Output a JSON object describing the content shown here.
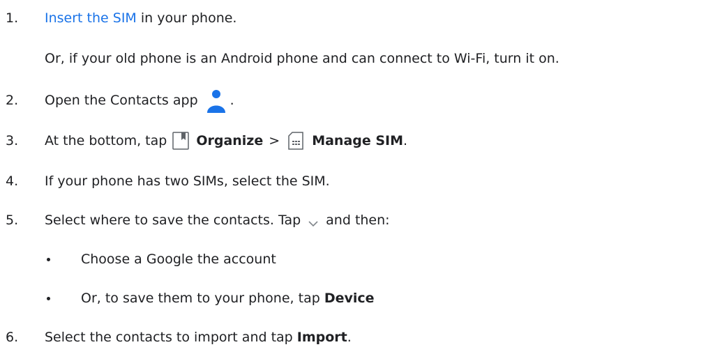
{
  "steps": [
    {
      "number": "1.",
      "link": "Insert the SIM",
      "text_after_link": " in your phone.",
      "note": "Or, if your old phone is an Android phone and can connect to Wi-Fi, turn it on."
    },
    {
      "number": "2.",
      "text_before_icon": "Open the Contacts app",
      "text_after_icon": "."
    },
    {
      "number": "3.",
      "text_before": "At the bottom, tap",
      "organize_label": "Organize",
      "separator": ">",
      "manage_sim_label": "Manage SIM",
      "text_end": "."
    },
    {
      "number": "4.",
      "text": "If your phone has two SIMs, select the SIM."
    },
    {
      "number": "5.",
      "text_before_icon": "Select where to save the contacts. Tap",
      "text_after_icon": "and then:",
      "bullets": [
        {
          "text": "Choose a Google the account"
        },
        {
          "text_before": "Or, to save them to your phone, tap ",
          "bold": "Device"
        }
      ]
    },
    {
      "number": "6.",
      "text_before": "Select the contacts to import and tap ",
      "bold": "Import",
      "text_end": "."
    }
  ],
  "colors": {
    "link": "#1a73e8",
    "text": "#202124",
    "contacts_icon": "#1a73e8",
    "icon_gray": "#5f6368"
  },
  "icons": {
    "contacts": "person-icon",
    "organize": "bookmark-icon",
    "manage_sim": "sim-card-icon",
    "dropdown": "chevron-down-icon"
  }
}
